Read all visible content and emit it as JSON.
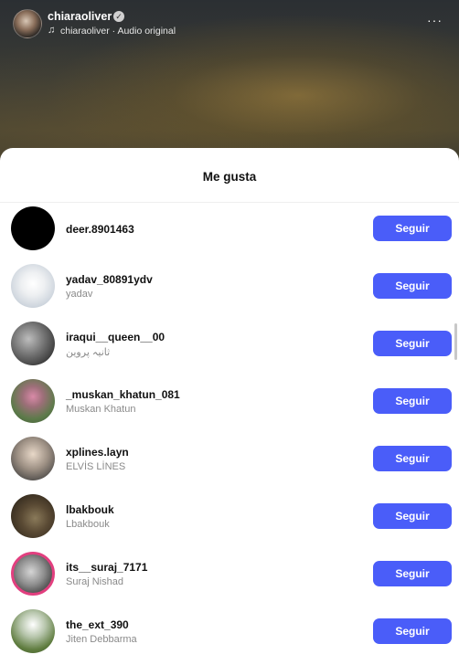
{
  "video": {
    "username": "chiaraoliver",
    "audio": "chiaraoliver · Audio original",
    "more_icon": "more-horizontal-icon",
    "music_icon": "music-note-icon",
    "verified_icon": "verified-badge-icon"
  },
  "sheet": {
    "title": "Me gusta"
  },
  "likers": [
    {
      "username": "deer.8901463",
      "fullname": "",
      "button": "Seguir"
    },
    {
      "username": "yadav_80891ydv",
      "fullname": "yadav",
      "button": "Seguir"
    },
    {
      "username": "iraqui__queen__00",
      "fullname": "ثانیہ پروین",
      "button": "Seguir"
    },
    {
      "username": "_muskan_khatun_081",
      "fullname": "Muskan Khatun",
      "button": "Seguir"
    },
    {
      "username": "xplines.layn",
      "fullname": "ELVİS LİNES",
      "button": "Seguir"
    },
    {
      "username": "lbakbouk",
      "fullname": "Lbakbouk",
      "button": "Seguir"
    },
    {
      "username": "its__suraj_7171",
      "fullname": "Suraj Nishad",
      "button": "Seguir"
    },
    {
      "username": "the_ext_390",
      "fullname": "Jiten Debbarma",
      "button": "Seguir"
    }
  ],
  "colors": {
    "follow_button": "#4a5df9",
    "story_ring": "#e23f7f"
  }
}
